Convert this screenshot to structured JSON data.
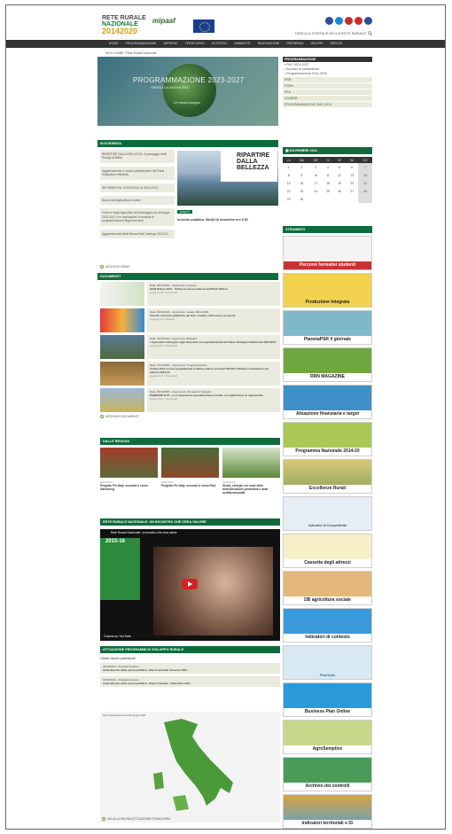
{
  "header": {
    "logo_line1": "RETE RURALE",
    "logo_line2": "NAZIONALE",
    "logo_line3": "20142020",
    "ministry": "mipaaf",
    "search_placeholder": "CERCA IL PORTALE DELLA RETE RURALE"
  },
  "nav": [
    "HOME",
    "PROGRAMMAZIONE",
    "IMPRESE",
    "TERRITORIO",
    "ACCESSO",
    "AMBIENTE",
    "INNOVAZIONE",
    "PRESENZA",
    "GRUPPI",
    "SERVIZI"
  ],
  "breadcrumb": "Sei in: HOME / Rete Rurale Nazionale",
  "hero": {
    "title": "PROGRAMMAZIONE 2023-2027",
    "subtitle": "VERSO LA NUOVA PAC",
    "caption": "Un nuovo impegno"
  },
  "programmazione": {
    "header": "PROGRAMMAZIONE",
    "items": [
      "PAC 2023-2027",
      "Accordo di partenariato",
      "Programmazione 2014-2020"
    ],
    "groups": [
      "PSR",
      "PSRN",
      "FEA",
      "LEADER",
      "PROGRAMMAZIONE 2007-2013"
    ]
  },
  "evidenza": {
    "header": "IN EVIDENZA",
    "items": [
      "RIPARTIRE DALLA BELLEZZA: il paesaggio delle Prealpi di Biella",
      "Aggiornamento e nuova pubblicazione del Rural Evaluation Helpdesk",
      "INFORMATIVA: il 29/10/2021 al 30/11/2021",
      "Banca dati Agricoltura Sociale",
      "Il ritorno degli Agricoltori del paesaggio con strategie 2023-2027 e le implicazioni in materia di programmazione degli interventi",
      "Aggiornamento della Banca Dati Catalogo 2014-20"
    ],
    "tag": "EVENTI",
    "caption": "Incontro pubblico, Biella 18 novembre ore 9.30",
    "rip_title": "RIPARTIRE DALLA BELLEZZA",
    "more": "ARCHIVIO NEWS"
  },
  "calendar": {
    "header": "NOVEMBRE 2021",
    "days": [
      "LU",
      "MA",
      "ME",
      "GI",
      "VE",
      "SA",
      "DO"
    ],
    "weeks": [
      [
        "1",
        "2",
        "3",
        "4",
        "5",
        "6",
        "7"
      ],
      [
        "8",
        "9",
        "10",
        "11",
        "12",
        "13",
        "14"
      ],
      [
        "15",
        "16",
        "17",
        "18",
        "19",
        "20",
        "21"
      ],
      [
        "22",
        "23",
        "24",
        "25",
        "26",
        "27",
        "28"
      ],
      [
        "29",
        "30",
        "",
        "",
        "",
        "",
        ""
      ]
    ]
  },
  "strumenti": {
    "header": "STRUMENTI",
    "items": [
      "Percorsi formativi studenti",
      "Produzione Integrata",
      "PianetaPSR il giornale",
      "RRN MAGAZINE",
      "Attuazione finanziaria e target",
      "Programma Nazionale 2014-20",
      "Eccellenze Rurali",
      "Indicatori di Competitività",
      "Cassetta degli attrezzi",
      "DB agricoltura sociale",
      "Indicatori di contesto",
      "FarmLab",
      "Business Plan Online",
      "AgroSemplice",
      "Archivio dei controlli",
      "Indicatori territoriali e IG"
    ]
  },
  "documenti": {
    "header": "DOCUMENTI",
    "items": [
      {
        "date": "Data: 05/11/2021 - Argomento: Impresa",
        "title": "SIAN Rilievo 2021 - Ordine la nuova edizione dell'ISAC Rilievo",
        "more": "Leggi di più / Download"
      },
      {
        "date": "Data: 04/11/2021 - Argomento: Leader 2014-2020",
        "title": "Attività e funzioni pubbliche dei GAL / Analisi, riflessioni e proposte",
        "more": "Leggi di più / Scarica"
      },
      {
        "date": "Data: 02/11/2021 - Argomento: Biologico",
        "title": "L'agricoltura biologica negli interventi non agroambientali del Piano Strategico Nazionale 2023-2027",
        "more": "Leggi di più / Download"
      },
      {
        "date": "Data: 27/10/2021 - Argomento: Programmazione",
        "title": "Analisi delle risorse programmate in Italia a valere sui fondi FEASR e FEAGA e transizione nel biennio 2021-22",
        "more": "Leggi di più / Download"
      },
      {
        "date": "Data: 25/10/2021 - Argomento: Ortoagrumi biologico",
        "title": "PSRNEWS N.15 - La cooperazione agroalimentare in Italia: un catalizzatore di opportunità",
        "more": "Leggi di più / Download"
      }
    ],
    "more": "ARCHIVIO DOCUMENTI"
  },
  "regioni": {
    "header": "DALLE REGIONI",
    "items": [
      {
        "date": "04/11/2021",
        "title": "Progetto Per Italy: secondo il corso Gardening"
      },
      {
        "date": "03/11/2021",
        "title": "Progetto Per Italy: secondo il corso Fast"
      },
      {
        "date": "22/10/2021",
        "title": "Sicilia, sinergie sul ruolo della diversificazione produttiva e della multifunzionalità"
      }
    ]
  },
  "video": {
    "header": "RETE RURALE NAZIONALE: UN INCONTRO CHE CREA VALORE",
    "title": "Rete Rurale Nazionale, un incontro che crea valore",
    "year": "2015-16",
    "provider": "Guarda su YouTube"
  },
  "attuazione": {
    "header": "ATTUAZIONE PROGRAMMI DI SVILUPPO RURALE",
    "subtitle": "Ultimi report pubblicati",
    "reports": [
      {
        "date": "22/10/2021 - Programmazione",
        "title": "Avanzamento della spesa pubblica - Report annuale trimestre 2021"
      },
      {
        "date": "15/10/2021 - Programmazione",
        "title": "Avanzamento della spesa pubblica - Report mensile - Settembre 2021"
      }
    ],
    "map_note": "Dati di avanzamento al 30 giugno 2021",
    "more": "VAI ALLA PAGINA ATTUAZIONE FINANZIARIA"
  }
}
